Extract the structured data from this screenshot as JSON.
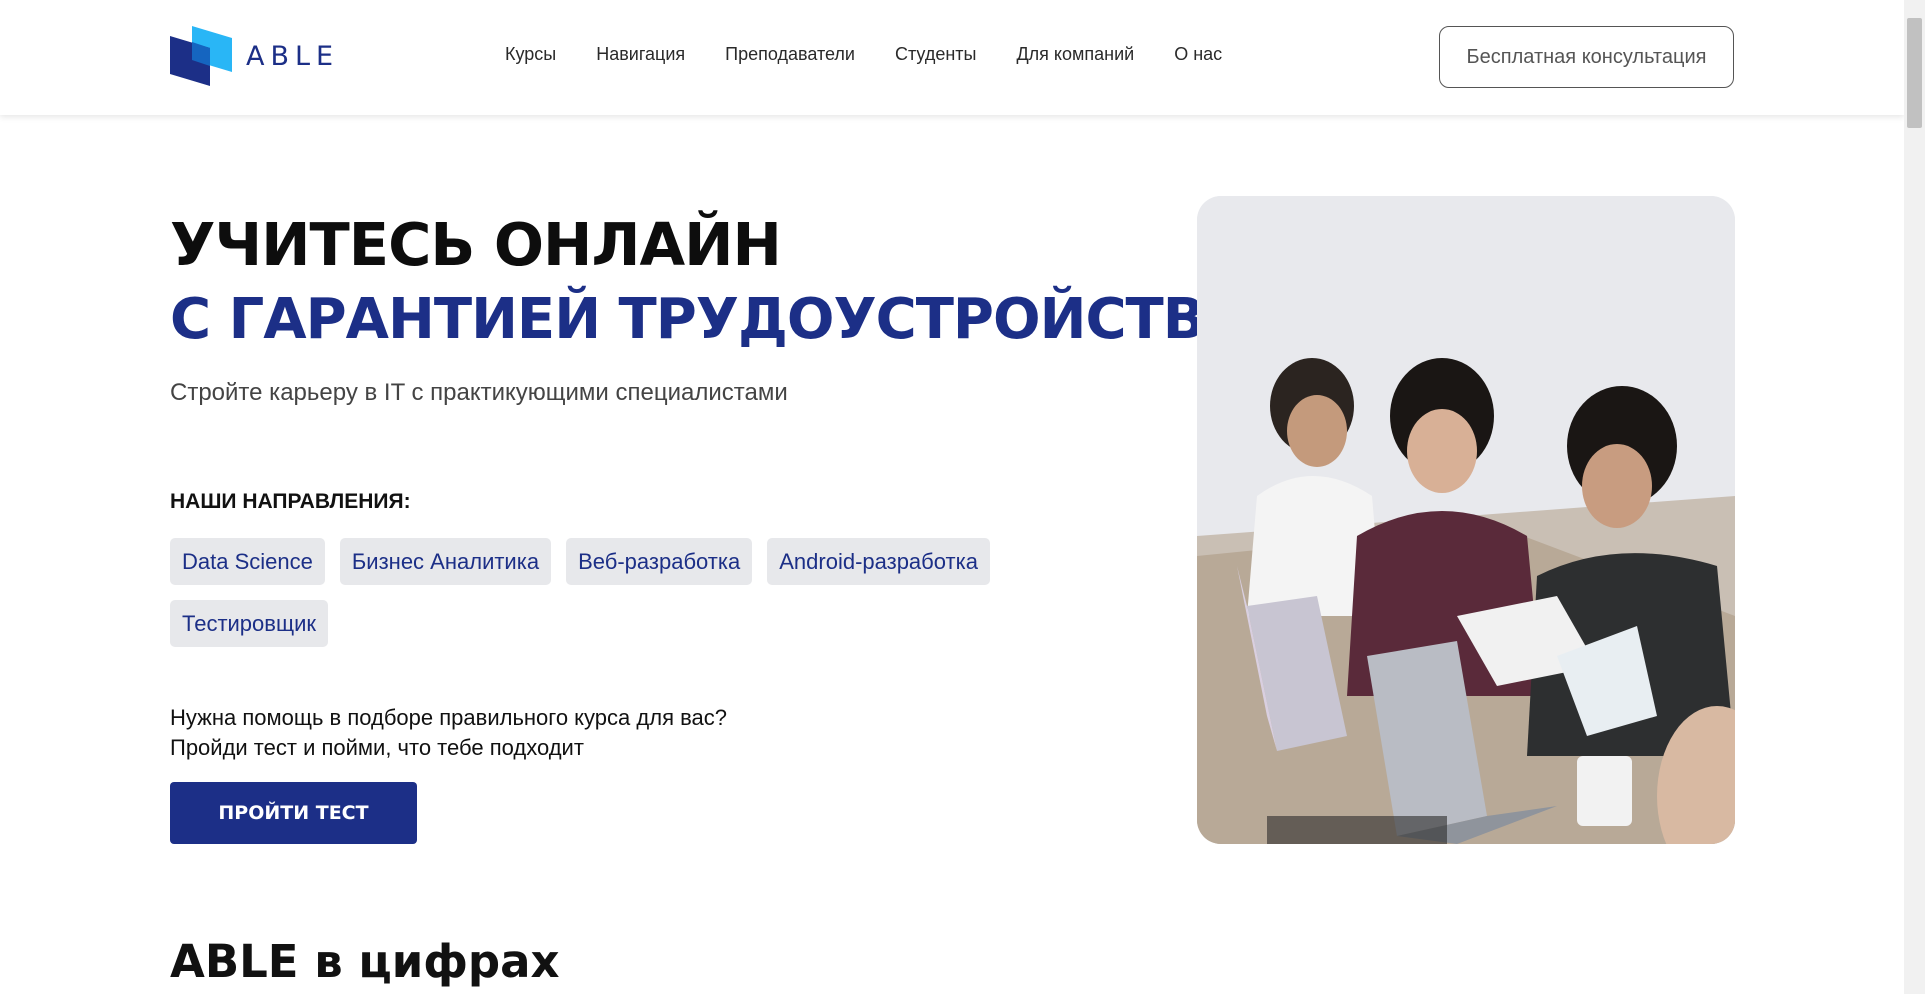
{
  "header": {
    "logo_text": "ABLE",
    "nav": [
      "Курсы",
      "Навигация",
      "Преподаватели",
      "Студенты",
      "Для компаний",
      "О нас"
    ],
    "consult_label": "Бесплатная консультация"
  },
  "hero": {
    "title_line1": "УЧИТЕСЬ ОНЛАЙН",
    "title_line2": "С ГАРАНТИЕЙ ТРУДОУСТРОЙСТВА",
    "subtitle": "Стройте карьеру в IT с практикующими специалистами",
    "directions_label": "НАШИ НАПРАВЛЕНИЯ:",
    "directions": [
      "Data Science",
      "Бизнес Аналитика",
      "Веб-разработка",
      "Android-разработка",
      "Тестировщик"
    ],
    "help_line1": "Нужна помощь в подборе правильного курса для вас?",
    "help_line2": "Пройди тест и пойми, что тебе подходит",
    "test_button": "ПРОЙТИ ТЕСТ"
  },
  "stats": {
    "heading": "ABLE в цифрах"
  },
  "colors": {
    "brand": "#1c2f87",
    "brand_light": "#29b6f6",
    "tag_bg": "#e7e8eb"
  }
}
